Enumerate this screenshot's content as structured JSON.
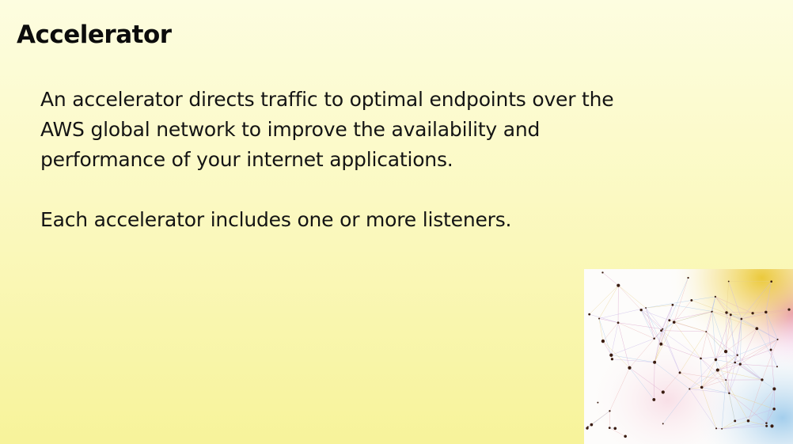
{
  "slide": {
    "title": "Accelerator",
    "paragraphs": [
      "An accelerator directs traffic to optimal endpoints over the AWS global network to improve the availability and performance of your internet applications.",
      "Each accelerator includes one or more listeners."
    ]
  },
  "decoration": {
    "image": "network-graph-image",
    "colors": {
      "background": "#fdfcfb",
      "nodes": "#3a1c10",
      "accent_yellow": "#e8c21a",
      "accent_magenta": "#d63ab8",
      "accent_blue": "#5aa8e0"
    }
  }
}
